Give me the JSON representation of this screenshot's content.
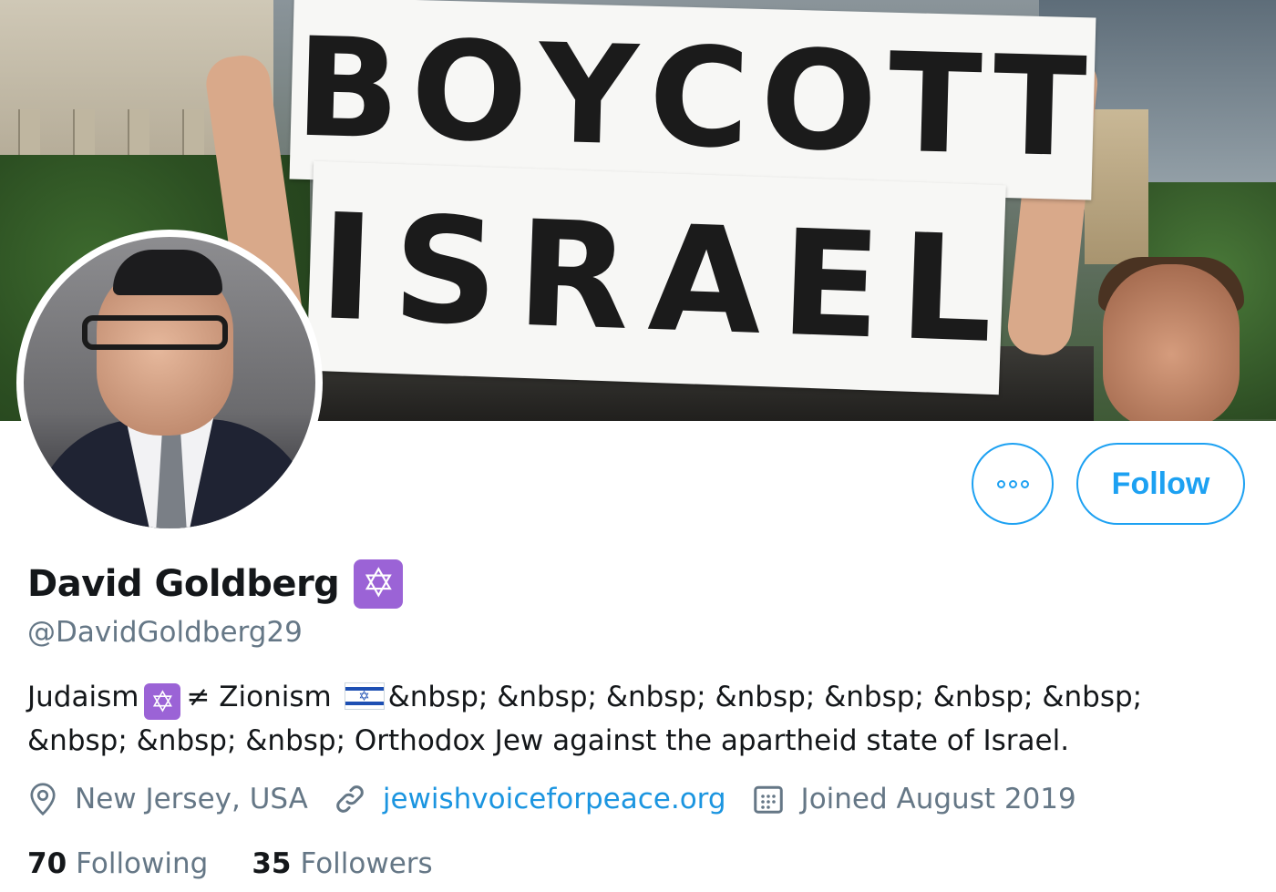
{
  "banner": {
    "sign_row1": [
      "B",
      "O",
      "Y",
      "C",
      "O",
      "T",
      "T"
    ],
    "sign_row2": [
      "I",
      "S",
      "R",
      "A",
      "E",
      "L"
    ]
  },
  "profile": {
    "display_name": "David Goldberg",
    "name_emoji": "✡",
    "handle": "@DavidGoldberg29",
    "bio": {
      "part1": "Judaism",
      "emoji_star": "✡",
      "part2": "≠ Zionism",
      "flag_star": "✡",
      "part3": "&nbsp; &nbsp; &nbsp; &nbsp; &nbsp; &nbsp; &nbsp; &nbsp; &nbsp; &nbsp; Orthodox Jew against the apartheid state of Israel."
    },
    "location": "New Jersey, USA",
    "website": "jewishvoiceforpeace.org",
    "joined": "Joined August 2019",
    "following_count": "70",
    "following_label": "Following",
    "followers_count": "35",
    "followers_label": "Followers"
  },
  "actions": {
    "follow_label": "Follow"
  },
  "icons": {
    "location": "location-pin-icon",
    "link": "link-icon",
    "calendar": "calendar-icon",
    "more": "more-options-icon"
  },
  "colors": {
    "accent": "#1da1f2",
    "link": "#1b95e0",
    "muted": "#657786",
    "text": "#14171a",
    "emoji_purple": "#9b63d6"
  }
}
